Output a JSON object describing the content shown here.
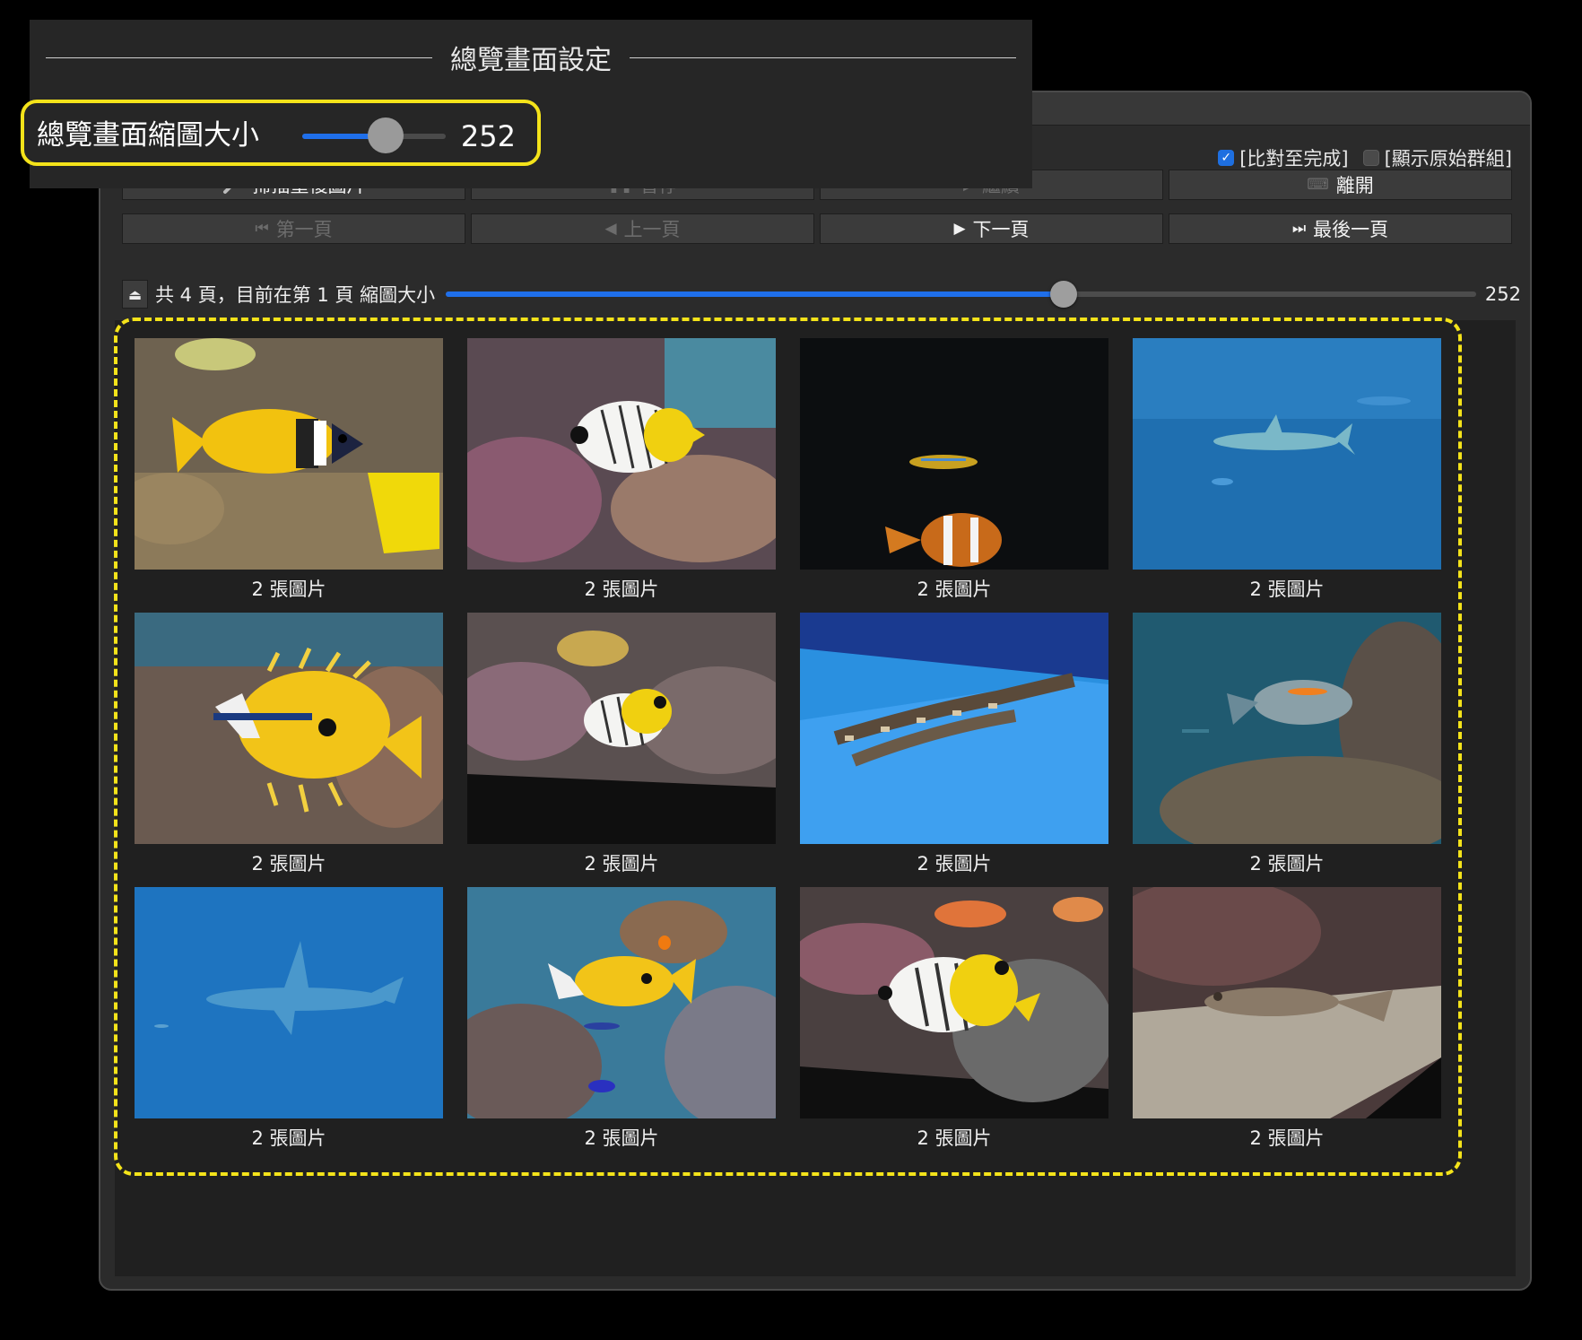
{
  "settings": {
    "title": "總覽畫面設定",
    "thumb_size_label": "總覽畫面縮圖大小",
    "thumb_size_value": "252",
    "thumb_size_slider_fraction": 0.58
  },
  "options": {
    "compare_until_done": "[比對至完成]",
    "compare_until_done_checked": true,
    "show_original_groups": "[顯示原始群組]",
    "show_original_groups_checked": false
  },
  "toolbar": {
    "scan": "掃描重複圖片",
    "pause": "暫停",
    "resume": "繼續",
    "leave": "離開"
  },
  "navigation": {
    "first": "第一頁",
    "prev": "上一頁",
    "next": "下一頁",
    "last": "最後一頁"
  },
  "pager": {
    "status": "共 4 頁，目前在第 1 頁 縮圖大小",
    "thumb_value": "252",
    "slider_fraction": 0.6
  },
  "colors": {
    "accent": "#1f6fea",
    "highlight": "#f4e31a"
  },
  "thumbnails": [
    {
      "caption": "2 張圖片",
      "subject": "yellow-rabbitfish"
    },
    {
      "caption": "2 張圖片",
      "subject": "threadfin-butterflyfish"
    },
    {
      "caption": "2 張圖片",
      "subject": "clownfish-dark-tank"
    },
    {
      "caption": "2 張圖片",
      "subject": "shark-blue-water"
    },
    {
      "caption": "2 張圖片",
      "subject": "rabbitfish-with-wrasse"
    },
    {
      "caption": "2 張圖片",
      "subject": "butterflyfish-on-reef"
    },
    {
      "caption": "2 張圖片",
      "subject": "bamboo-sharks"
    },
    {
      "caption": "2 張圖片",
      "subject": "surgeonfish"
    },
    {
      "caption": "2 張圖片",
      "subject": "hammerhead-shark"
    },
    {
      "caption": "2 張圖片",
      "subject": "rabbitfish-reef"
    },
    {
      "caption": "2 張圖片",
      "subject": "butterflyfish-closeup"
    },
    {
      "caption": "2 張圖片",
      "subject": "bottom-fish-sand"
    }
  ]
}
